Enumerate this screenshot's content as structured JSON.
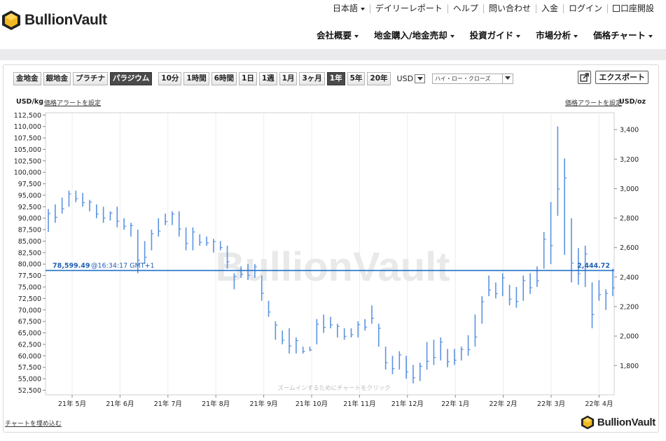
{
  "header": {
    "logo_text": "BullionVault",
    "top_links": [
      "日本語",
      "デイリーレポート",
      "ヘルプ",
      "問い合わせ",
      "入金",
      "ログイン",
      "口座開設"
    ],
    "nav": [
      "会社概要",
      "地金購入/地金売却",
      "投資ガイド",
      "市場分析",
      "価格チャート"
    ],
    "nav_active": "価格チャート"
  },
  "toolbar": {
    "metals": [
      "金地金",
      "銀地金",
      "プラチナ",
      "パラジウム"
    ],
    "metal_active": "パラジウム",
    "ranges": [
      "10分",
      "1時間",
      "6時間",
      "1日",
      "1週",
      "1月",
      "3ヶ月",
      "1年",
      "5年",
      "20年"
    ],
    "range_active": "1年",
    "currency": "USD",
    "chart_style": "ハイ・ロー・クローズ",
    "export_label": "エクスポート"
  },
  "labels": {
    "unit_left": "USD/kg",
    "unit_right": "USD/oz",
    "price_alert": "価格アラートを設定",
    "embed": "チャートを埋め込む",
    "zoom_hint": "ズームインするためにチャートをクリック",
    "watermark": "BullionVault",
    "current_price_kg": "78,599.49",
    "current_time": "@16:34:17 GMT+1",
    "current_price_oz": "2,444.72",
    "footer_logo": "BullionVault"
  },
  "colors": {
    "bar": "#5b93e0",
    "line": "#1f6fc8",
    "label": "#1f5fb0",
    "accent": "#c9a227"
  },
  "chart_data": {
    "type": "hlc",
    "title": "",
    "x_ticks": [
      "21年 5月",
      "21年 6月",
      "21年 7月",
      "21年 8月",
      "21年 9月",
      "21年 10月",
      "21年 11月",
      "21年 12月",
      "22年 1月",
      "22年 2月",
      "22年 3月",
      "22年 4月"
    ],
    "y_left": {
      "label": "USD/kg",
      "min": 51500,
      "max": 113000,
      "ticks": [
        52500,
        55000,
        57500,
        60000,
        62500,
        65000,
        67500,
        70000,
        72500,
        75000,
        77500,
        80000,
        82500,
        85000,
        87500,
        90000,
        92500,
        95000,
        97500,
        100000,
        102500,
        105000,
        107500,
        110000,
        112500
      ]
    },
    "y_right": {
      "label": "USD/oz",
      "ticks": [
        1800,
        2000,
        2200,
        2400,
        2600,
        2800,
        3000,
        3200,
        3400
      ]
    },
    "current_value_kg": 78599.49,
    "current_value_oz": 2444.72,
    "weekly_ranges_kg": [
      [
        87000,
        92000
      ],
      [
        89000,
        93000
      ],
      [
        91000,
        94500
      ],
      [
        92500,
        96000
      ],
      [
        93500,
        96000
      ],
      [
        92500,
        95500
      ],
      [
        91500,
        94000
      ],
      [
        90000,
        93000
      ],
      [
        89000,
        92500
      ],
      [
        89500,
        91500
      ],
      [
        88000,
        92500
      ],
      [
        87500,
        90000
      ],
      [
        86000,
        89000
      ],
      [
        78000,
        87500
      ],
      [
        80000,
        85000
      ],
      [
        83000,
        87500
      ],
      [
        86000,
        90000
      ],
      [
        88500,
        91000
      ],
      [
        88500,
        91500
      ],
      [
        86000,
        91500
      ],
      [
        83000,
        88000
      ],
      [
        83000,
        88000
      ],
      [
        84000,
        86500
      ],
      [
        84000,
        86000
      ],
      [
        82500,
        85500
      ],
      [
        83000,
        85000
      ],
      [
        79000,
        84000
      ],
      [
        74500,
        78000
      ],
      [
        77000,
        79500
      ],
      [
        76500,
        80000
      ],
      [
        77000,
        80000
      ],
      [
        72000,
        77500
      ],
      [
        68500,
        72000
      ],
      [
        63500,
        67500
      ],
      [
        62500,
        65500
      ],
      [
        60500,
        66000
      ],
      [
        60500,
        64000
      ],
      [
        60500,
        62000
      ],
      [
        61000,
        62000
      ],
      [
        62500,
        68000
      ],
      [
        65000,
        69000
      ],
      [
        66000,
        68500
      ],
      [
        64000,
        67000
      ],
      [
        63500,
        66000
      ],
      [
        64000,
        66000
      ],
      [
        64000,
        67500
      ],
      [
        65500,
        68000
      ],
      [
        67000,
        71000
      ],
      [
        62000,
        67000
      ],
      [
        57000,
        62000
      ],
      [
        56000,
        60000
      ],
      [
        57000,
        61000
      ],
      [
        55000,
        60000
      ],
      [
        54000,
        58000
      ],
      [
        54500,
        58500
      ],
      [
        57000,
        63000
      ],
      [
        58000,
        63500
      ],
      [
        59000,
        64000
      ],
      [
        57500,
        61500
      ],
      [
        58000,
        61500
      ],
      [
        59000,
        62000
      ],
      [
        60000,
        64500
      ],
      [
        62000,
        69000
      ],
      [
        67000,
        73000
      ],
      [
        73000,
        77500
      ],
      [
        72500,
        76000
      ],
      [
        73000,
        78000
      ],
      [
        71000,
        75500
      ],
      [
        70500,
        75000
      ],
      [
        72000,
        77500
      ],
      [
        73500,
        78000
      ],
      [
        75000,
        79500
      ],
      [
        79000,
        87000
      ],
      [
        80000,
        93500
      ],
      [
        90500,
        110000
      ],
      [
        82000,
        103000
      ],
      [
        76000,
        90000
      ],
      [
        75500,
        83500
      ],
      [
        75000,
        84000
      ],
      [
        66000,
        76000
      ],
      [
        72000,
        76500
      ],
      [
        70000,
        74500
      ],
      [
        73000,
        79000
      ]
    ]
  }
}
